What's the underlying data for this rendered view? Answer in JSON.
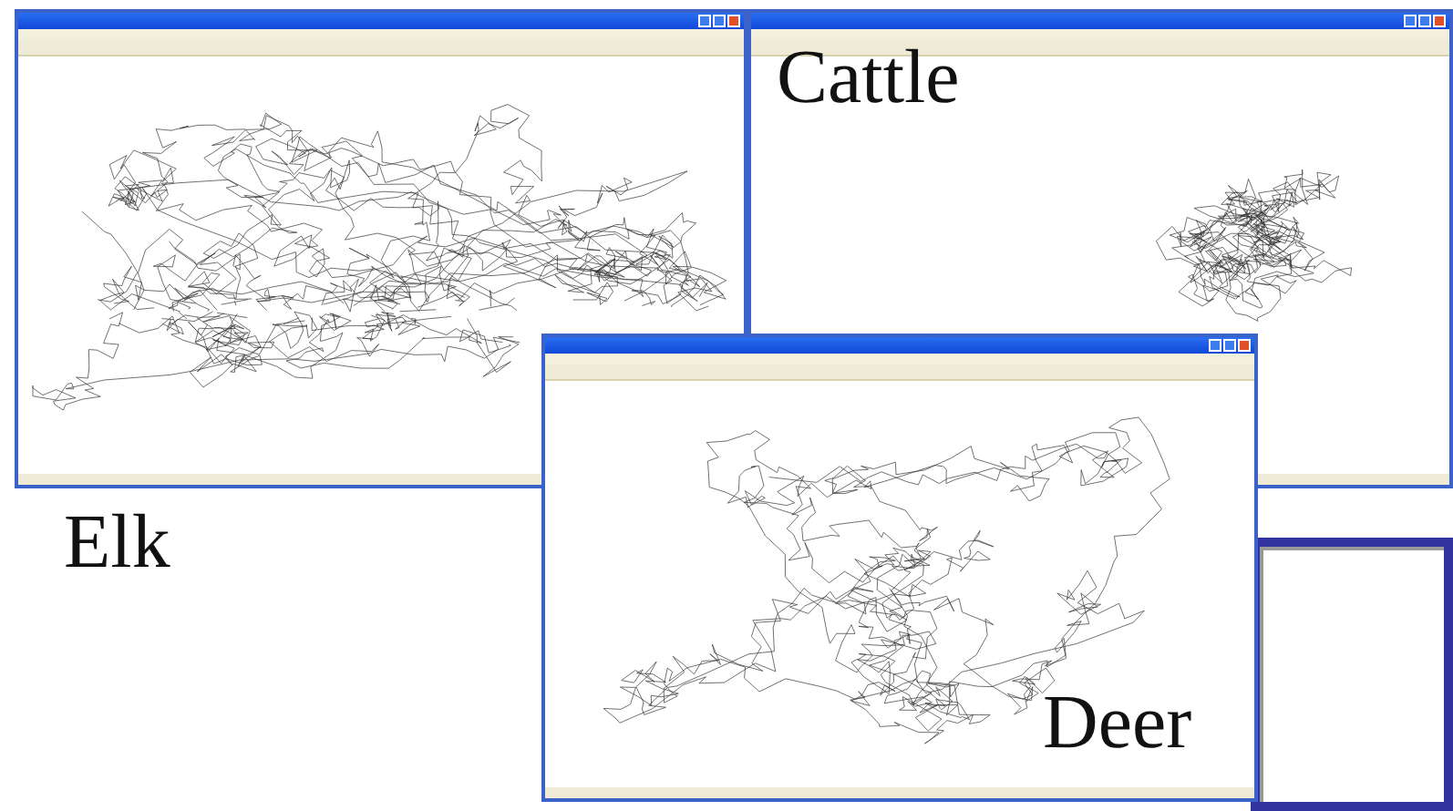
{
  "windows": [
    {
      "kind": "plot",
      "caption": "Elk"
    },
    {
      "kind": "plot",
      "caption": "Cattle"
    },
    {
      "kind": "blank"
    },
    {
      "kind": "plot",
      "caption": "Deer"
    }
  ]
}
